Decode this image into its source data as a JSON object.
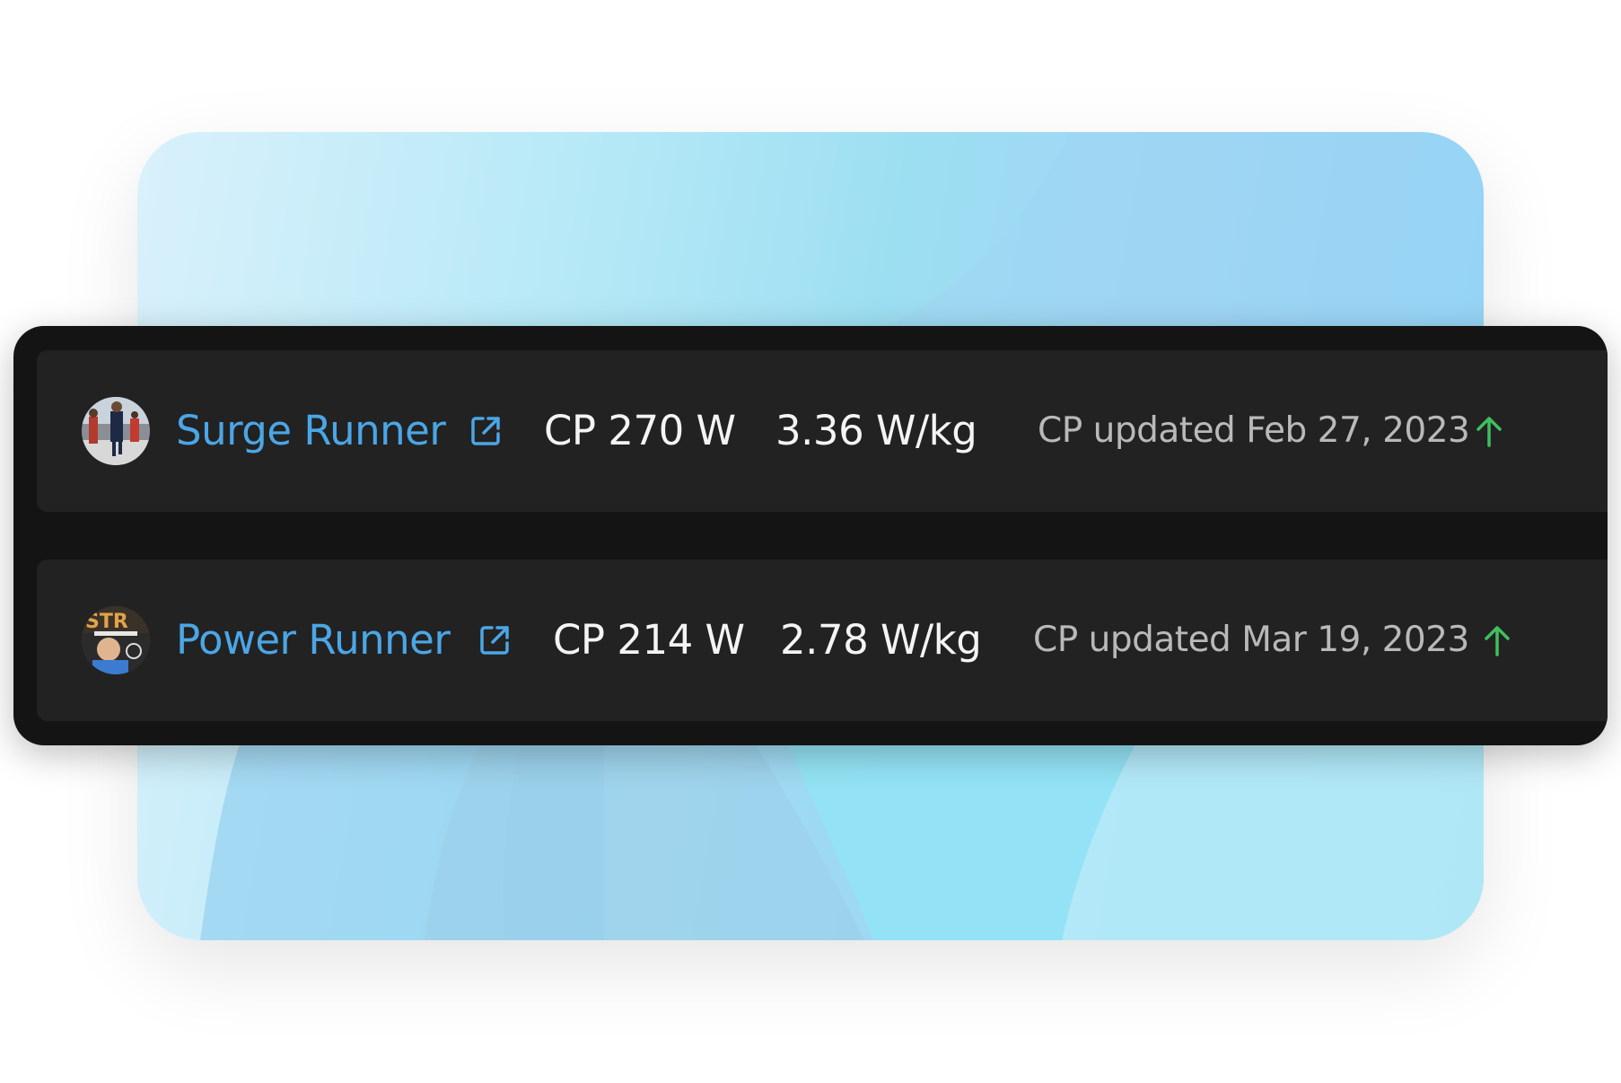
{
  "colors": {
    "name_link": "#4ba6e6",
    "trend_up": "#3fbf5f",
    "panel_bg": "#141414",
    "row_bg": "#222222",
    "primary_text": "#f4f4f4",
    "secondary_text": "#b9b9b9"
  },
  "runners": [
    {
      "name": "Surge Runner",
      "avatar_icon": "avatar-photo-icon",
      "link_icon": "external-link-icon",
      "cp": "CP 270 W",
      "wkg": "3.36 W/kg",
      "updated": "CP updated Feb 27, 2023",
      "trend_icon": "arrow-up-icon"
    },
    {
      "name": "Power Runner",
      "avatar_icon": "avatar-photo-icon",
      "link_icon": "external-link-icon",
      "cp": "CP 214 W",
      "wkg": "2.78 W/kg",
      "updated": "CP updated Mar 19, 2023",
      "trend_icon": "arrow-up-icon"
    }
  ]
}
